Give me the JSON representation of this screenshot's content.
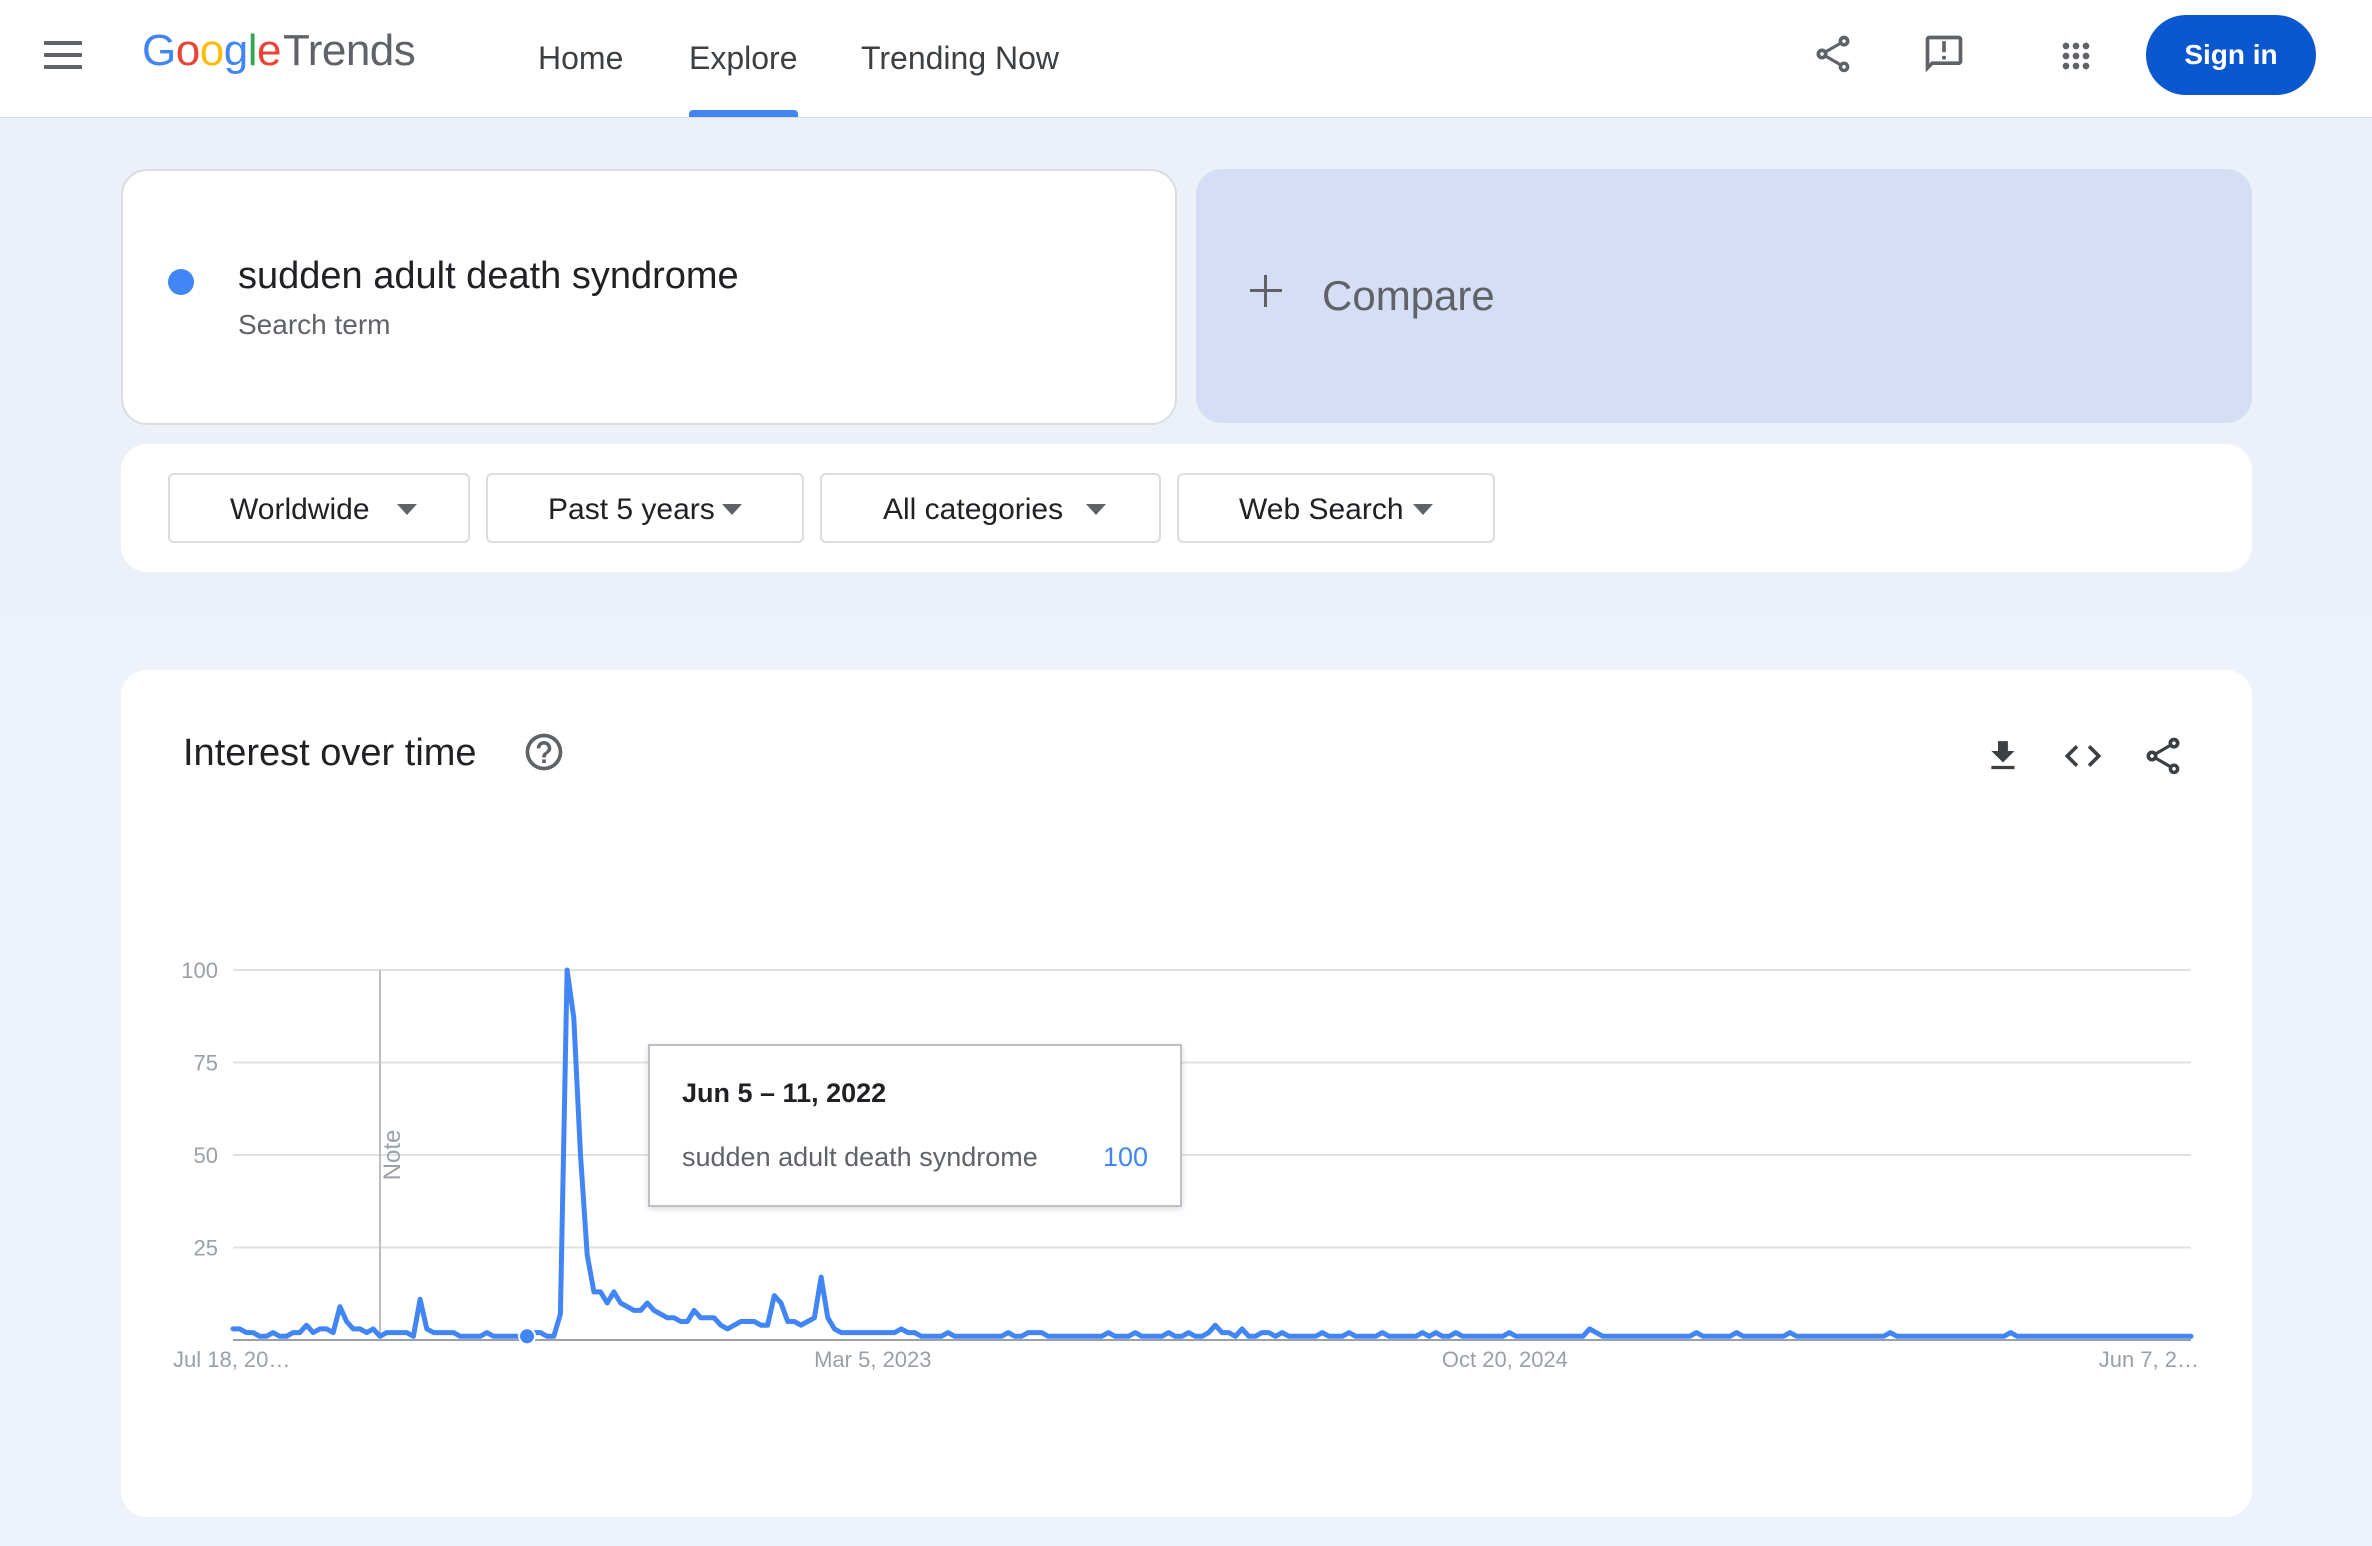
{
  "header": {
    "logo_google": [
      "G",
      "o",
      "o",
      "g",
      "l",
      "e"
    ],
    "logo_trends": "Trends",
    "nav": [
      {
        "label": "Home",
        "active": false
      },
      {
        "label": "Explore",
        "active": true
      },
      {
        "label": "Trending Now",
        "active": false
      }
    ],
    "icons": [
      "share-icon",
      "feedback-icon",
      "apps-icon"
    ],
    "sign_in": "Sign in"
  },
  "search": {
    "term": "sudden adult death syndrome",
    "term_type": "Search term",
    "term_color": "#4285f4",
    "compare_label": "Compare"
  },
  "filters": [
    {
      "label": "Worldwide"
    },
    {
      "label": "Past 5 years"
    },
    {
      "label": "All categories"
    },
    {
      "label": "Web Search"
    }
  ],
  "chart_card": {
    "title": "Interest over time",
    "icons": [
      "help-icon",
      "download-icon",
      "embed-icon",
      "share-icon"
    ],
    "note_label": "Note",
    "tooltip": {
      "date": "Jun 5 – 11, 2022",
      "term": "sudden adult death syndrome",
      "value": "100"
    }
  },
  "chart_data": {
    "type": "line",
    "series": [
      {
        "name": "sudden adult death syndrome",
        "color": "#4285f4",
        "values": [
          3,
          3,
          2,
          2,
          1,
          1,
          2,
          1,
          1,
          2,
          2,
          4,
          2,
          3,
          3,
          2,
          9,
          5,
          3,
          3,
          2,
          3,
          1,
          2,
          2,
          2,
          2,
          1,
          11,
          3,
          2,
          2,
          2,
          2,
          1,
          1,
          1,
          1,
          2,
          1,
          1,
          1,
          1,
          1,
          1,
          2,
          2,
          1,
          1,
          7,
          100,
          87,
          50,
          23,
          13,
          13,
          10,
          13,
          10,
          9,
          8,
          8,
          10,
          8,
          7,
          6,
          6,
          5,
          5,
          8,
          6,
          6,
          6,
          4,
          3,
          4,
          5,
          5,
          5,
          4,
          4,
          12,
          10,
          5,
          5,
          4,
          5,
          6,
          17,
          6,
          3,
          2,
          2,
          2,
          2,
          2,
          2,
          2,
          2,
          2,
          3,
          2,
          2,
          1,
          1,
          1,
          1,
          2,
          1,
          1,
          1,
          1,
          1,
          1,
          1,
          1,
          2,
          1,
          1,
          2,
          2,
          2,
          1,
          1,
          1,
          1,
          1,
          1,
          1,
          1,
          1,
          2,
          1,
          1,
          1,
          2,
          1,
          1,
          1,
          1,
          2,
          1,
          1,
          2,
          1,
          1,
          2,
          4,
          2,
          2,
          1,
          3,
          1,
          1,
          2,
          2,
          1,
          2,
          1,
          1,
          1,
          1,
          1,
          2,
          1,
          1,
          1,
          2,
          1,
          1,
          1,
          1,
          2,
          1,
          1,
          1,
          1,
          1,
          2,
          1,
          2,
          1,
          1,
          2,
          1,
          1,
          1,
          1,
          1,
          1,
          1,
          2,
          1,
          1,
          1,
          1,
          1,
          1,
          1,
          1,
          1,
          1,
          1,
          3,
          2,
          1,
          1,
          1,
          1,
          1,
          1,
          1,
          1,
          1,
          1,
          1,
          1,
          1,
          1,
          2,
          1,
          1,
          1,
          1,
          1,
          2,
          1,
          1,
          1,
          1,
          1,
          1,
          1,
          2,
          1,
          1,
          1,
          1,
          1,
          1,
          1,
          1,
          1,
          1,
          1,
          1,
          1,
          1,
          2,
          1,
          1,
          1,
          1,
          1,
          1,
          1,
          1,
          1,
          1,
          1,
          1,
          1,
          1,
          1,
          1,
          1,
          2,
          1,
          1,
          1,
          1,
          1,
          1,
          1,
          1,
          1,
          1,
          1,
          1,
          1,
          1,
          1,
          1,
          1,
          1,
          1,
          1,
          1,
          1,
          1,
          1,
          1,
          1,
          1
        ]
      }
    ],
    "x_start": "Jul 18, 20…",
    "x_ticks": [
      {
        "label": "Jul 18, 20…",
        "index": 0
      },
      {
        "label": "Mar 5, 2023",
        "index": 83
      },
      {
        "label": "Oct 20, 2024",
        "index": 165
      },
      {
        "label": "Jun 7, 2…",
        "index": 254
      }
    ],
    "y_ticks": [
      25,
      50,
      75,
      100
    ],
    "ylim": [
      0,
      100
    ],
    "note_index": 22,
    "highlight_index": 44,
    "grid": true
  }
}
